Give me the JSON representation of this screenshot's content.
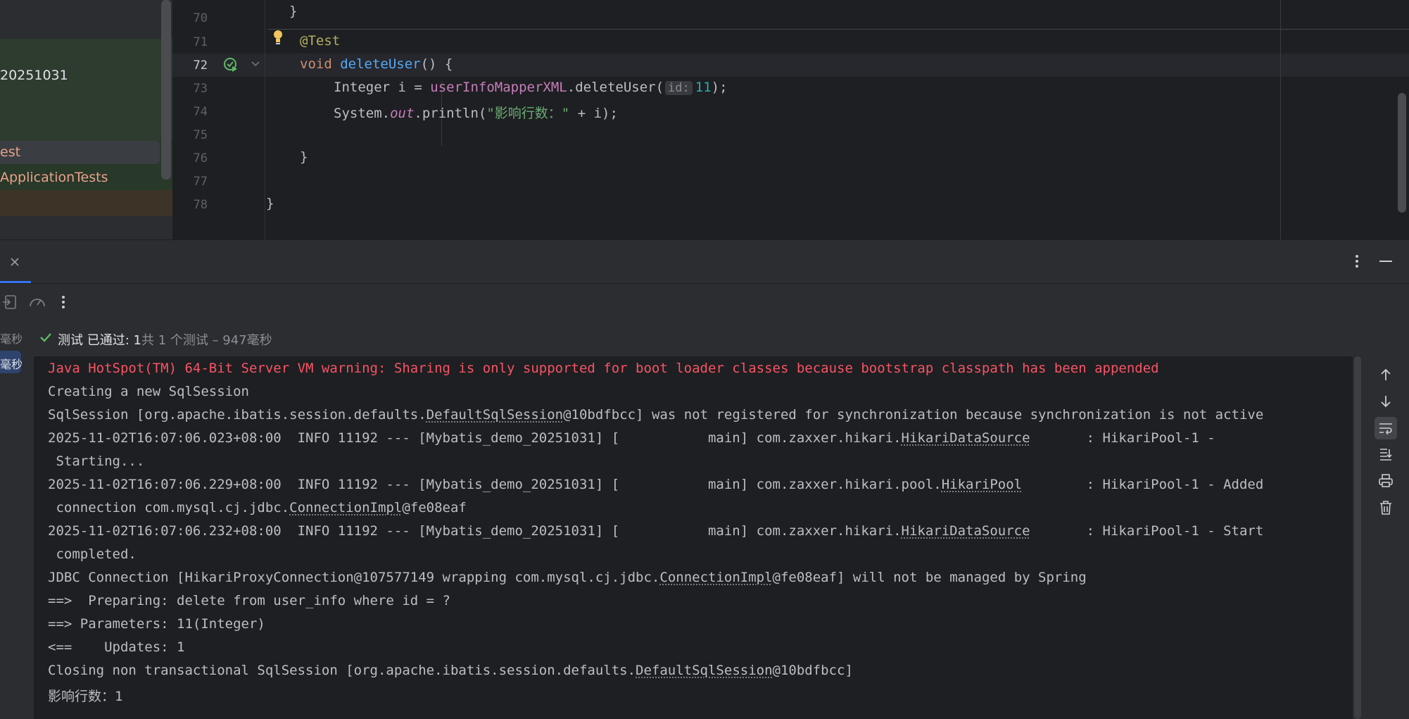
{
  "project_tree": {
    "items": [
      {
        "label": "20251031"
      },
      {
        "label": "est"
      },
      {
        "label": "ApplicationTests"
      }
    ]
  },
  "editor": {
    "line_numbers": [
      "70",
      "71",
      "72",
      "73",
      "74",
      "75",
      "76",
      "77",
      "78"
    ],
    "code": {
      "l71_annotation": "@Test",
      "l72_kw": "void",
      "l72_fn": "deleteUser",
      "l72_rest": "() {",
      "l73_type": "Integer i = ",
      "l73_field": "userInfoMapperXML",
      "l73_call": ".deleteUser(",
      "l73_hint": "id:",
      "l73_num": "11",
      "l73_end": ");",
      "l74_sys": "System.",
      "l74_out": "out",
      "l74_call": ".println(",
      "l74_str": "\"影响行数：\"",
      "l74_end": " + i);",
      "l76": "}",
      "l78": "}"
    }
  },
  "run_panel": {
    "status": {
      "prefix": "测试 已通过: 1",
      "suffix": "共 1 个测试 – 947毫秒"
    },
    "left_items": [
      "毫秒",
      "毫秒"
    ],
    "console": {
      "lines": [
        {
          "type": "err",
          "text": "Java HotSpot(TM) 64-Bit Server VM warning: Sharing is only supported for boot loader classes because bootstrap classpath has been appended"
        },
        {
          "text": "Creating a new SqlSession"
        },
        {
          "a": "SqlSession [org.apache.ibatis.session.defaults.",
          "u": "DefaultSqlSession",
          "b": "@10bdfbcc] was not registered for synchronization because synchronization is not active"
        },
        {
          "a": "2025-11-02T16:07:06.023+08:00  INFO 11192 --- [Mybatis_demo_20251031] [           main] com.zaxxer.hikari.",
          "u": "HikariDataSource",
          "b": "       : HikariPool-1 -"
        },
        {
          "text": " Starting..."
        },
        {
          "a": "2025-11-02T16:07:06.229+08:00  INFO 11192 --- [Mybatis_demo_20251031] [           main] com.zaxxer.hikari.pool.",
          "u": "HikariPool",
          "b": "        : HikariPool-1 - Added"
        },
        {
          "a": " connection com.mysql.cj.jdbc.",
          "u": "ConnectionImpl",
          "b": "@fe08eaf"
        },
        {
          "a": "2025-11-02T16:07:06.232+08:00  INFO 11192 --- [Mybatis_demo_20251031] [           main] com.zaxxer.hikari.",
          "u": "HikariDataSource",
          "b": "       : HikariPool-1 - Start"
        },
        {
          "text": " completed."
        },
        {
          "a": "JDBC Connection [HikariProxyConnection@107577149 wrapping com.mysql.cj.jdbc.",
          "u": "ConnectionImpl",
          "b": "@fe08eaf] will not be managed by Spring"
        },
        {
          "text": "==>  Preparing: delete from user_info where id = ?"
        },
        {
          "text": "==> Parameters: 11(Integer)"
        },
        {
          "text": "<==    Updates: 1"
        },
        {
          "a": "Closing non transactional SqlSession [org.apache.ibatis.session.defaults.",
          "u": "DefaultSqlSession",
          "b": "@10bdfbcc]"
        },
        {
          "text": "影响行数：1"
        }
      ]
    }
  },
  "colors": {
    "accent": "#3574f0",
    "pass_green": "#5fb865",
    "error_red": "#f75464"
  },
  "icons": [
    "close-icon",
    "more-vertical-icon",
    "minimize-icon",
    "exit-icon",
    "gauge-icon",
    "more-vertical-icon",
    "check-icon",
    "bulb-icon",
    "run-test-icon",
    "fold-icon",
    "arrow-up-icon",
    "arrow-down-icon",
    "soft-wrap-icon",
    "scroll-to-end-icon",
    "print-icon",
    "trash-icon"
  ]
}
